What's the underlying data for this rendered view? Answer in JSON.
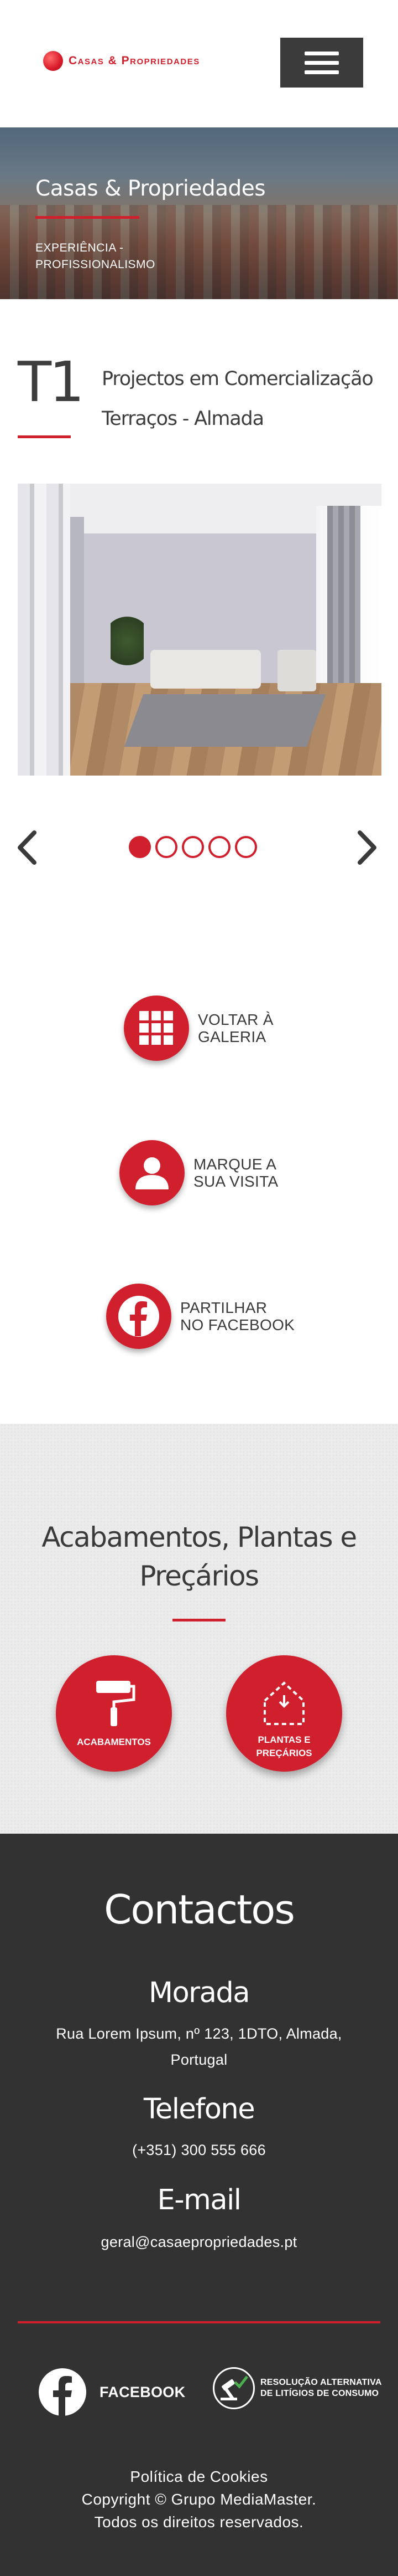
{
  "header": {
    "logo_text": "Casas & Propriedades",
    "menu_icon": "hamburger-icon",
    "brand_color": "#d0202e"
  },
  "hero": {
    "title": "Casas & Propriedades",
    "subtitle_line1": "EXPERIÊNCIA -",
    "subtitle_line2": "PROFISSIONALISMO"
  },
  "project": {
    "typology": "T1",
    "line1": "Projectos em Comercialização",
    "line2": "Terraços - Almada"
  },
  "carousel": {
    "prev_icon": "chevron-left-icon",
    "next_icon": "chevron-right-icon",
    "slide_count": 5,
    "active_index": 0
  },
  "actions": [
    {
      "line1": "VOLTAR À",
      "line2": "GALERIA",
      "icon": "grid-icon"
    },
    {
      "line1": "MARQUE A",
      "line2": "SUA VISITA",
      "icon": "user-icon"
    },
    {
      "line1": "PARTILHAR",
      "line2": "NO FACEBOOK",
      "icon": "facebook-icon"
    }
  ],
  "finishes": {
    "title_line1": "Acabamentos, Plantas e",
    "title_line2": "Preçários",
    "buttons": [
      {
        "label": "ACABAMENTOS",
        "icon": "paint-roller-icon"
      },
      {
        "label_line1": "PLANTAS E",
        "label_line2": "PREÇÁRIOS",
        "icon": "house-plan-icon"
      }
    ]
  },
  "footer": {
    "title": "Contactos",
    "address_heading": "Morada",
    "address_line1": "Rua Lorem Ipsum, nº 123, 1DTO, Almada,",
    "address_line2": "Portugal",
    "phone_heading": "Telefone",
    "phone": "(+351) 300 555 666",
    "email_heading": "E-mail",
    "email": "geral@casaepropriedades.pt",
    "facebook_label": "FACEBOOK",
    "ral_line1": "RESOLUÇÃO ALTERNATIVA",
    "ral_line2": "DE LITÍGIOS DE CONSUMO",
    "cookie_link": "Política de Cookies",
    "copyright": "Copyright © Grupo MediaMaster.",
    "rights": "Todos os direitos reservados."
  }
}
